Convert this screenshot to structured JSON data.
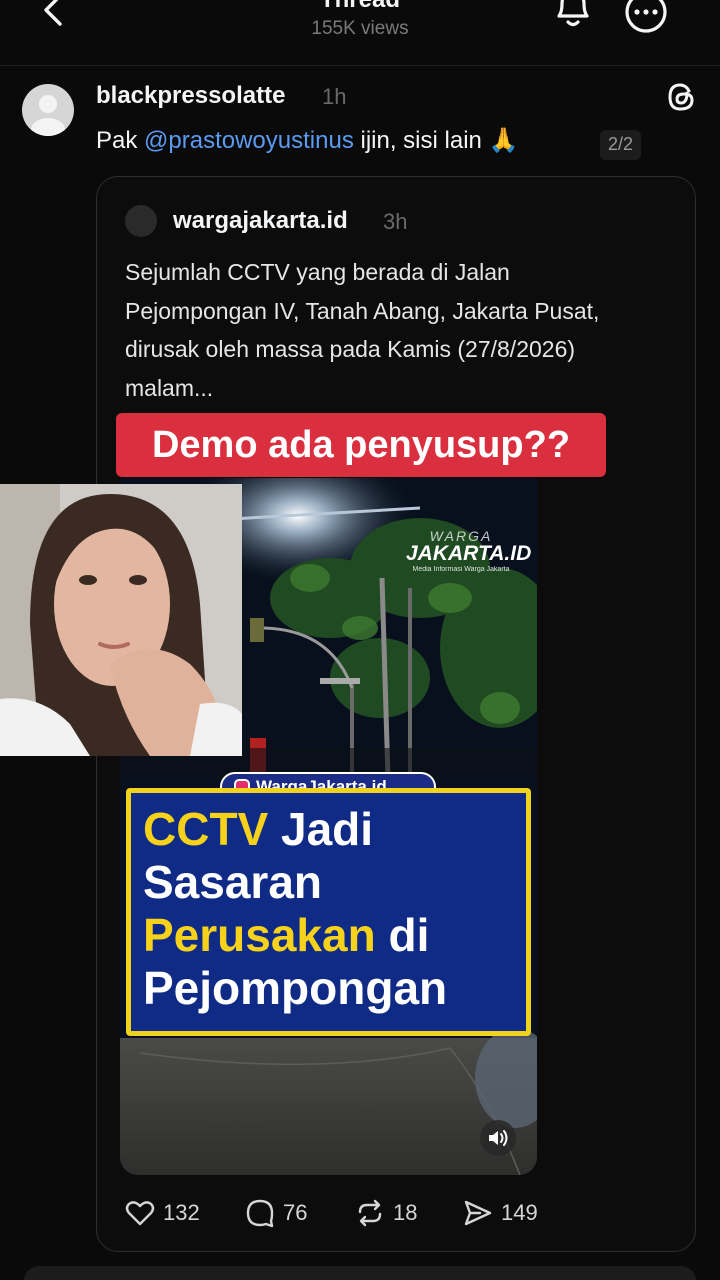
{
  "header": {
    "title": "Thread",
    "views": "155K views"
  },
  "post": {
    "username": "blackpressolatte",
    "time": "1h",
    "text_prefix": "Pak ",
    "mention": "@prastowoyustinus",
    "text_suffix": " ijin, sisi lain 🙏",
    "pager": "2/2"
  },
  "quote": {
    "username": "wargajakarta.id",
    "time": "3h",
    "text": "Sejumlah CCTV yang berada di Jalan Pejompongan IV, Tanah Abang, Jakarta Pusat, dirusak oleh massa pada Kamis (27/8/2026) malam..."
  },
  "overlay": {
    "caption": "Demo ada penyusup??"
  },
  "video": {
    "watermark_top": "WARGA",
    "watermark_main": "JAKARTA.ID",
    "watermark_sub": "Media Informasi Warga Jakarta",
    "badge": "WargaJakarta.id",
    "headline": {
      "l1_yellow": "CCTV",
      "l1_white": " Jadi",
      "l2": "Sasaran",
      "l3_yellow": "Perusakan",
      "l3_white": " di",
      "l4": "Pejompongan"
    }
  },
  "actions": {
    "likes": "132",
    "replies": "76",
    "reposts": "18",
    "shares": "149"
  },
  "colors": {
    "background": "#0a0a0a",
    "mention": "#5b9bf2",
    "caption_bg": "#d92f3e",
    "panel_bg": "#0f2b86",
    "panel_border": "#f1d21c"
  }
}
